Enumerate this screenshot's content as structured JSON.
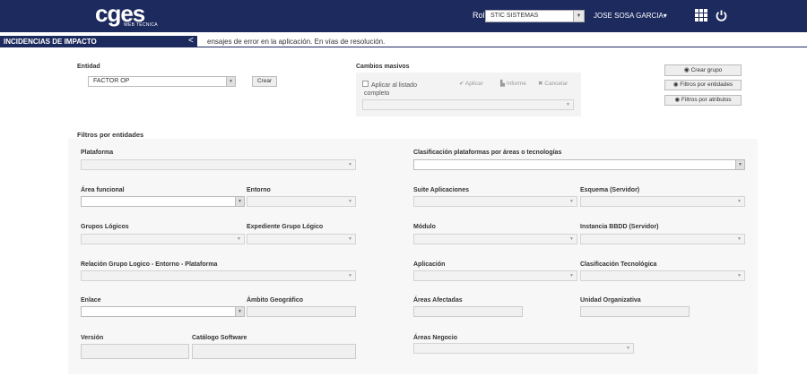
{
  "header": {
    "logo_text": "cges",
    "logo_subtitle": "WEB TÉCNICA",
    "rol_label": "Rol:",
    "rol_value": "STIC SISTEMAS",
    "user_name": "JOSE SOSA GARCIA▾",
    "bg_color": "#1d2a5e"
  },
  "banner": {
    "title": "INCIDENCIAS DE IMPACTO",
    "arrow": "<",
    "message": "ensajes de error en la aplicación. En vías de resolución."
  },
  "entidad": {
    "label": "Entidad",
    "value": "FACTOR OP",
    "crear_button": "Crear"
  },
  "cambios_masivos": {
    "title": "Cambios masivos",
    "checkbox_label": "Aplicar al listado completo",
    "aplicar": "✔ Aplicar",
    "informe": "Informe",
    "cancelar": "✖ Cancelar"
  },
  "right_buttons": {
    "crear_grupo": "Crear grupo",
    "filtros_entidades": "Filtros por entidades",
    "filtros_atributos": "Filtros por atributos"
  },
  "filtros": {
    "title": "Filtros por entidades",
    "plataforma": "Plataforma",
    "clasificacion_plataformas": "Clasificación plataformas por áreas o tecnologías",
    "area_funcional": "Área funcional",
    "entorno": "Entorno",
    "suite_aplicaciones": "Suite Aplicaciones",
    "esquema_servidor": "Esquema (Servidor)",
    "grupos_logicos": "Grupos Lógicos",
    "expediente_grupo_logico": "Expediente Grupo Lógico",
    "modulo": "Módulo",
    "instancia_bbdd": "Instancia BBDD (Servidor)",
    "relacion_grupo": "Relación Grupo Logico - Entorno - Plataforma",
    "aplicacion": "Aplicación",
    "clasificacion_tecnologica": "Clasificación Tecnológica",
    "enlace": "Enlace",
    "ambito_geografico": "Ámbito Geográfico",
    "areas_afectadas": "Áreas Afectadas",
    "unidad_organizativa": "Unidad Organizativa",
    "version": "Versión",
    "catalogo_software": "Catálogo Software",
    "areas_negocio": "Áreas Negocio"
  }
}
